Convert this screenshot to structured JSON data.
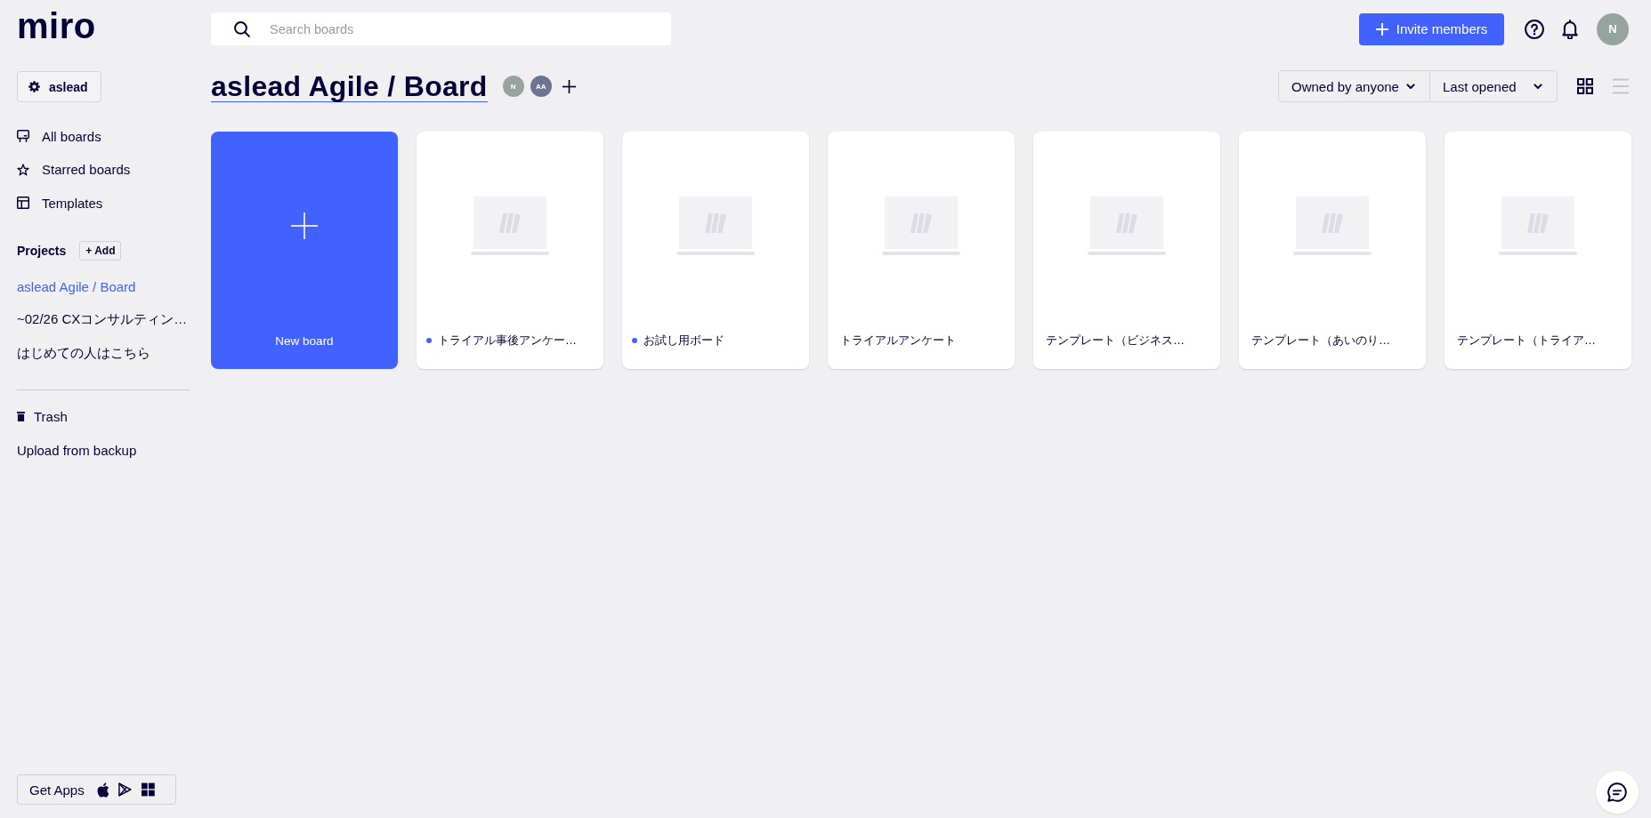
{
  "logo": {
    "text": "miro"
  },
  "search": {
    "placeholder": "Search boards"
  },
  "top_bar": {
    "invite_button": {
      "label": "Invite members"
    },
    "user_avatar": {
      "initials": "N",
      "color": "#97a39f"
    }
  },
  "sidebar": {
    "workspace": {
      "label": "aslead"
    },
    "nav": [
      {
        "label": "All boards",
        "kind": "boards",
        "selected": false
      },
      {
        "label": "Starred boards",
        "kind": "starred",
        "selected": false
      },
      {
        "label": "Templates",
        "kind": "templates",
        "selected": false
      }
    ],
    "projects": {
      "title": "Projects",
      "add_button": "+ Add",
      "items": [
        {
          "label": "aslead Agile / Board",
          "selected": true
        },
        {
          "label": "~02/26 CXコンサルティン…",
          "selected": false
        },
        {
          "label": "はじめての人はこちら",
          "selected": false
        }
      ]
    },
    "footer_links": [
      {
        "label": "Trash",
        "kind": "trash"
      },
      {
        "label": "Upload from backup",
        "kind": "plain"
      }
    ],
    "get_apps": {
      "label": "Get Apps"
    }
  },
  "page": {
    "title": "aslead Agile / Board",
    "members": [
      {
        "initials": "N",
        "color": "#97a39f"
      },
      {
        "initials": "AA",
        "color": "#6b7590"
      }
    ],
    "filters": [
      {
        "label": "Owned by anyone"
      },
      {
        "label": "Last opened"
      }
    ],
    "view_modes": [
      {
        "kind": "grid",
        "selected": true
      },
      {
        "kind": "list",
        "selected": false
      }
    ]
  },
  "boards": [
    {
      "kind": "new",
      "title": "New board"
    },
    {
      "kind": "board",
      "title": "トライアル事後アンケー…",
      "dot": true
    },
    {
      "kind": "board",
      "title": "お試し用ボード",
      "dot": true
    },
    {
      "kind": "board",
      "title": "トライアルアンケート",
      "dot": false
    },
    {
      "kind": "board",
      "title": "テンプレート（ビジネス…",
      "dot": false
    },
    {
      "kind": "board",
      "title": "テンプレート（あいのり…",
      "dot": false
    },
    {
      "kind": "board",
      "title": "テンプレート（トライア…",
      "dot": false
    }
  ]
}
